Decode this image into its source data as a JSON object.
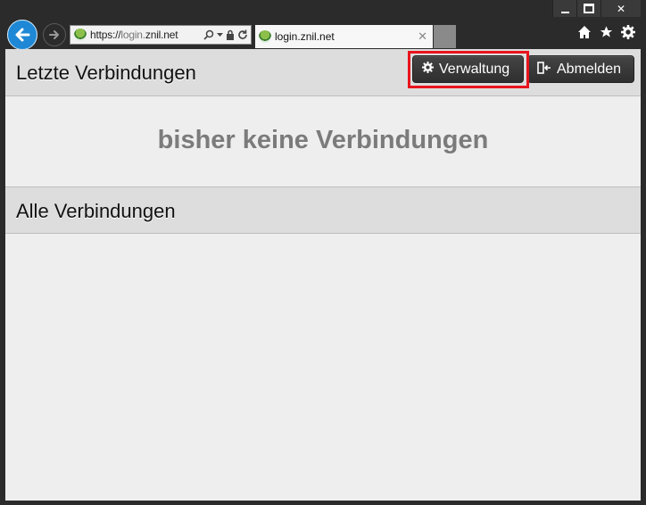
{
  "browser": {
    "address_url_scheme": "https://",
    "address_url_sub": "login.",
    "address_url_domain": "znil.net",
    "tab_title": "login.znil.net"
  },
  "icons": {
    "back": "back-arrow-icon",
    "forward": "forward-arrow-icon",
    "favicon": "site-favicon-icon",
    "search": "search-icon",
    "lock": "lock-icon",
    "refresh": "refresh-icon",
    "home": "home-icon",
    "favorites": "star-icon",
    "settings": "gear-icon"
  },
  "page": {
    "recent_title": "Letzte Verbindungen",
    "manage_button": "Verwaltung",
    "logout_button": "Abmelden",
    "empty_message": "bisher keine Verbindungen",
    "all_title": "Alle Verbindungen"
  },
  "colors": {
    "highlight": "#e8141c",
    "back_button": "#1e88d6"
  }
}
